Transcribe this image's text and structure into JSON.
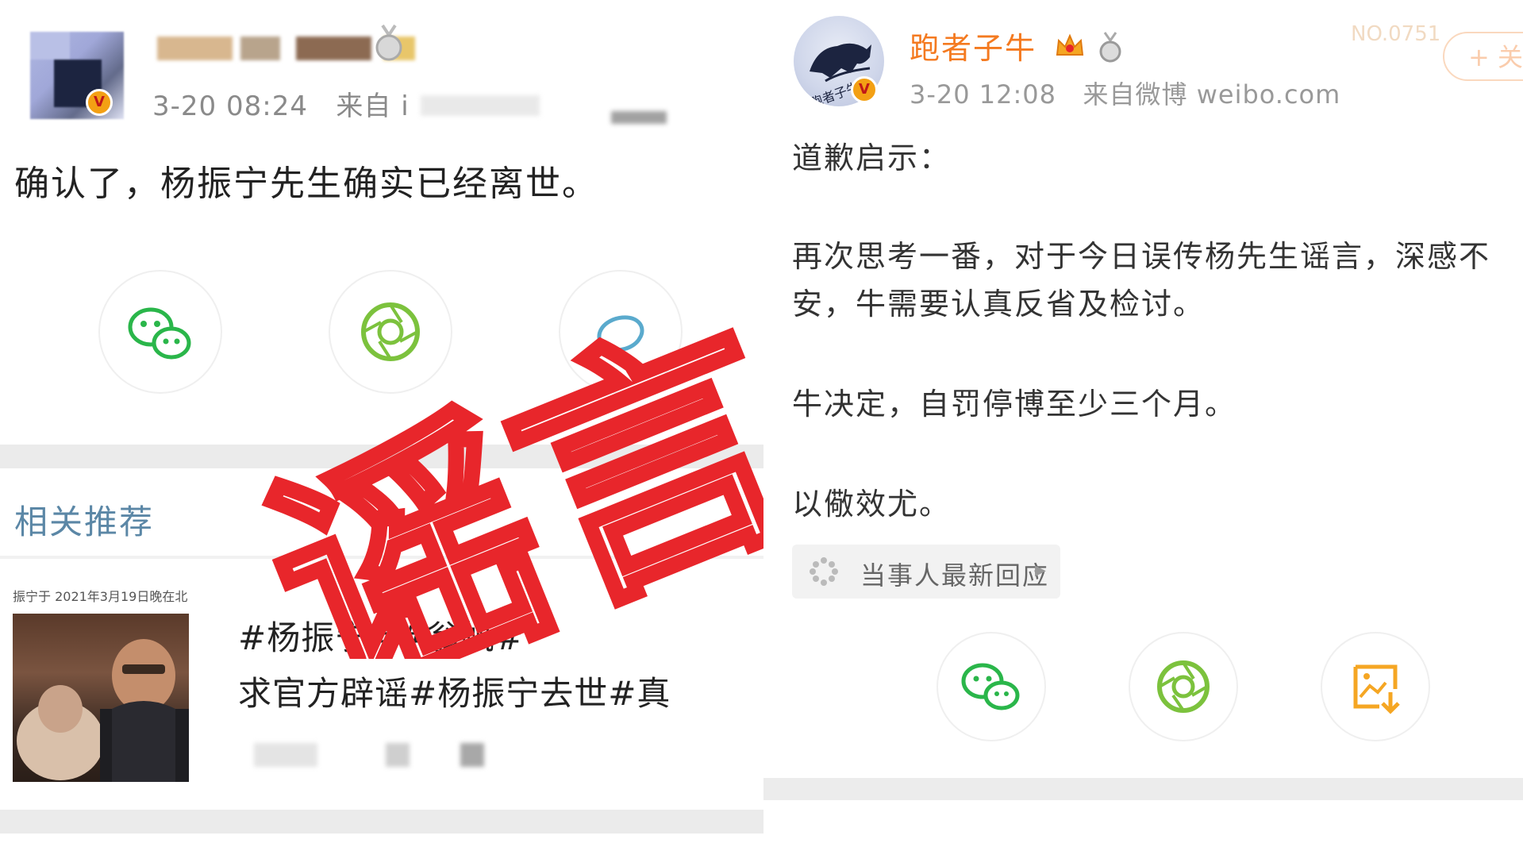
{
  "left_post": {
    "time": "3-20 08:24",
    "source_prefix": "来自 i",
    "content": "确认了，杨振宁先生确实已经离世。",
    "stamp_text": "谣言",
    "related": {
      "title": "相关推荐",
      "thumb_caption": "振宁于 2021年3月19日晚在北",
      "hashtags_line1": "#杨振宁##翁帆#",
      "hashtags_line2": "求官方辟谣#杨振宁去世#真"
    },
    "share_icons": [
      "wechat-icon",
      "moments-icon",
      "weibo-icon"
    ]
  },
  "right_post": {
    "username": "跑者子牛",
    "avatar_text": "跑者子牛",
    "time": "3-20 12:08",
    "source": "来自微博 weibo.com",
    "follow_label": "+ 关",
    "corner_number": "NO.0751",
    "paragraphs": [
      "道歉启示：",
      "再次思考一番，对于今日误传杨先生谣言，深感不",
      "安，牛需要认真反省及检讨。",
      "牛决定，自罚停博至少三个月。",
      "以儆效尤。"
    ],
    "response_pill": "当事人最新回应",
    "share_icons": [
      "wechat-icon",
      "moments-icon",
      "save-image-icon"
    ]
  },
  "colors": {
    "stamp_red": "#e8262b",
    "username_orange": "#f47a20",
    "wechat_green": "#2ab64a",
    "moments_green": "#7cc23d",
    "save_orange": "#f5a623",
    "related_blue": "#5b87a6"
  }
}
